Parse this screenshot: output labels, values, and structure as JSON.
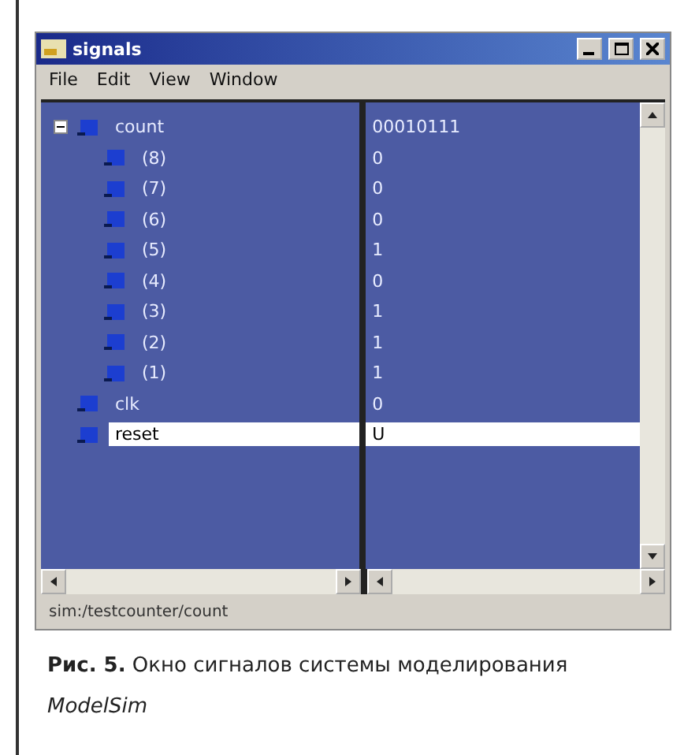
{
  "window": {
    "title": "signals"
  },
  "menu": [
    "File",
    "Edit",
    "View",
    "Window"
  ],
  "signals": [
    {
      "name": "count",
      "value": "00010111",
      "expanded": true,
      "selected": false,
      "children": [
        {
          "name": "(8)",
          "value": "0",
          "selected": false
        },
        {
          "name": "(7)",
          "value": "0",
          "selected": false
        },
        {
          "name": "(6)",
          "value": "0",
          "selected": false
        },
        {
          "name": "(5)",
          "value": "1",
          "selected": false
        },
        {
          "name": "(4)",
          "value": "0",
          "selected": false
        },
        {
          "name": "(3)",
          "value": "1",
          "selected": false
        },
        {
          "name": "(2)",
          "value": "1",
          "selected": false
        },
        {
          "name": "(1)",
          "value": "1",
          "selected": false
        }
      ]
    },
    {
      "name": "clk",
      "value": "0",
      "selected": false
    },
    {
      "name": "reset",
      "value": "U",
      "selected": true
    }
  ],
  "status_bar": "sim:/testcounter/count",
  "caption": "**Рис. 5.** Окно сигналов системы моделирования *ModelSim*"
}
